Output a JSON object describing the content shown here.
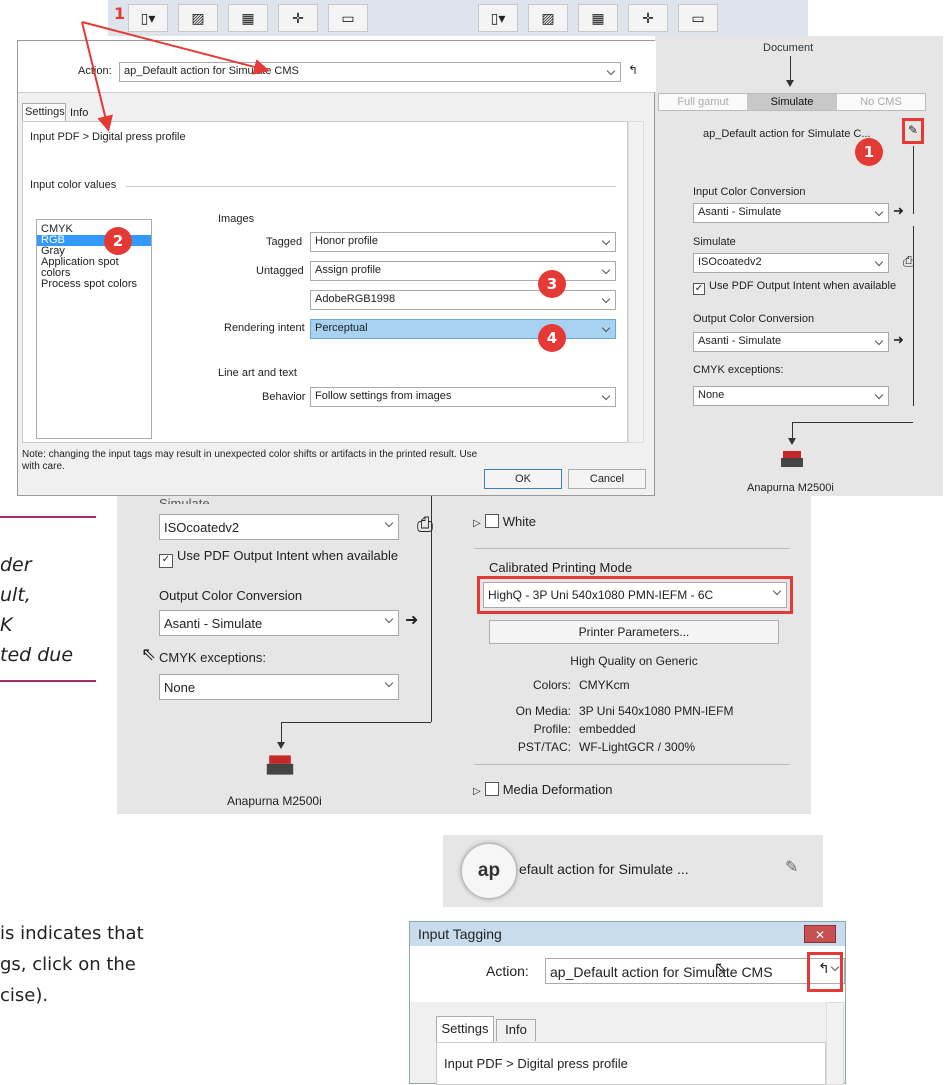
{
  "toolbar": {
    "badge": "1"
  },
  "panel1": {
    "action_label": "Action:",
    "action_value": "ap_Default action for Simulate CMS",
    "tabs": [
      "Settings",
      "Info"
    ],
    "breadcrumb": "Input PDF  >  Digital press profile",
    "group_title": "Input color values",
    "list": [
      "CMYK",
      "RGB",
      "Gray",
      "Application spot colors",
      "Process spot colors"
    ],
    "images_header": "Images",
    "tagged_label": "Tagged",
    "tagged_value": "Honor profile",
    "untagged_label": "Untagged",
    "untagged_value": "Assign profile",
    "profile_value": "AdobeRGB1998",
    "intent_label": "Rendering intent",
    "intent_value": "Perceptual",
    "line_art_header": "Line art and text",
    "behavior_label": "Behavior",
    "behavior_value": "Follow settings from images",
    "note": "Note: changing the input tags may result in unexpected color shifts or artifacts in the printed result. Use with care.",
    "ok": "OK",
    "cancel": "Cancel",
    "badges": [
      "2",
      "3",
      "4"
    ]
  },
  "panel2": {
    "document": "Document",
    "modes": [
      "Full gamut",
      "Simulate",
      "No CMS"
    ],
    "action_name": "ap_Default action for Simulate C...",
    "badge": "1",
    "input_conv_label": "Input Color Conversion",
    "input_conv_value": "Asanti - Simulate",
    "simulate_label": "Simulate",
    "simulate_value": "ISOcoatedv2",
    "use_pdf_label": "Use PDF Output Intent when available",
    "output_conv_label": "Output Color Conversion",
    "output_conv_value": "Asanti - Simulate",
    "cmyk_label": "CMYK exceptions:",
    "cmyk_value": "None",
    "printer": "Anapurna M2500i"
  },
  "panel3": {
    "simulate_label": "Simulate",
    "simulate_value": "ISOcoatedv2",
    "use_pdf_label": "Use PDF Output Intent when available",
    "output_conv_label": "Output Color Conversion",
    "output_conv_value": "Asanti - Simulate",
    "cmyk_label": "CMYK exceptions:",
    "cmyk_value": "None",
    "printer": "Anapurna M2500i"
  },
  "panel4": {
    "white": "White",
    "mode_label": "Calibrated Printing Mode",
    "mode_value": "HighQ - 3P Uni 540x1080 PMN-IEFM - 6C",
    "printer_params": "Printer Parameters...",
    "quality": "High Quality on Generic",
    "colors_k": "Colors:",
    "colors_v": "CMYKcm",
    "media_k": "On Media:",
    "media_v": "3P Uni 540x1080 PMN-IEFM",
    "profile_k": "Profile:",
    "profile_v": "embedded",
    "pst_k": "PST/TAC:",
    "pst_v": "WF-LightGCR / 300%",
    "media_deform": "Media Deformation"
  },
  "side_text": [
    "der",
    "ult,",
    "K",
    "ted due"
  ],
  "ap_strip": {
    "logo": "ap",
    "text": "efault action for Simulate ..."
  },
  "bottom_text": [
    "is indicates that",
    "gs, click on the",
    "cise)."
  ],
  "input_tagging": {
    "title": "Input Tagging",
    "close": "✕",
    "action_label": "Action:",
    "action_value": "ap_Default action for Simulate CMS",
    "tabs": [
      "Settings",
      "Info"
    ],
    "breadcrumb": "Input PDF  >  Digital press profile"
  },
  "colors": {
    "accent_red": "#e53935",
    "selection_blue": "#3399ff",
    "panel_gray": "#e6e6e6"
  }
}
